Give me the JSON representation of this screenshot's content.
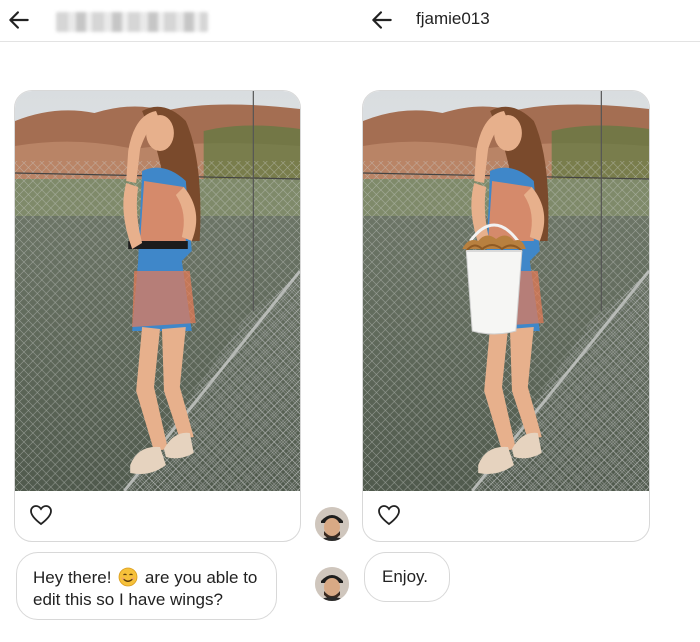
{
  "left_pane": {
    "header": {
      "back_icon": "arrow-left-icon",
      "title_blurred": true
    },
    "post": {
      "like_icon": "heart-outline-icon"
    },
    "message": {
      "text_before_emoji": "Hey there!",
      "emoji": "smiling-face-emoji",
      "text_after_emoji": "are you able to edit this so I have wings?"
    }
  },
  "right_pane": {
    "header": {
      "back_icon": "arrow-left-icon",
      "username": "fjamie013"
    },
    "post": {
      "like_icon": "heart-outline-icon"
    },
    "message": {
      "text": "Enjoy."
    }
  },
  "colors": {
    "background": "#ffffff",
    "border": "#d8d8d8",
    "text": "#222222",
    "emoji_face": "#f6c13a"
  }
}
